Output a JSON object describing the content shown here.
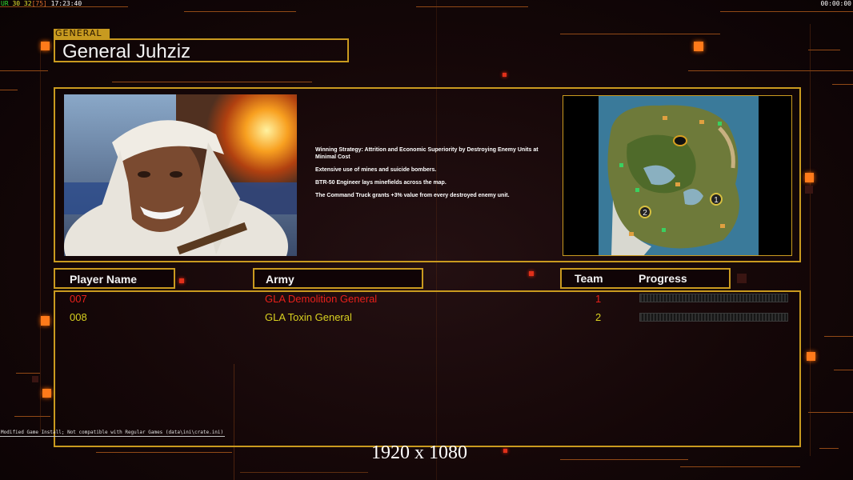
{
  "hud": {
    "left_prefix": "UR",
    "left_values": "30 32",
    "left_bracket": "[75]",
    "time": "17:23:40",
    "right_time": "00:00:00"
  },
  "title_tag": "GENERAL",
  "general_name": "General Juhziz",
  "description": [
    "Winning Strategy: Attrition and Economic Superiority by Destroying Enemy Units at Minimal Cost",
    "Extensive use of mines and suicide bombers.",
    "BTR-50 Engineer lays minefields across the map.",
    "The Command Truck grants +3% value from every destroyed enemy unit."
  ],
  "columns": {
    "player": "Player Name",
    "army": "Army",
    "team": "Team",
    "progress": "Progress"
  },
  "players": [
    {
      "name": "007",
      "army": "GLA Demolition General",
      "team": "1",
      "color": "#e8201a"
    },
    {
      "name": "008",
      "army": "GLA Toxin General",
      "team": "2",
      "color": "#d8d020"
    }
  ],
  "map_markers": [
    "1",
    "2"
  ],
  "warning": "Modified Game Install; Not compatible with Regular Games (data\\ini\\crate.ini)",
  "resolution": "1920 x 1080"
}
